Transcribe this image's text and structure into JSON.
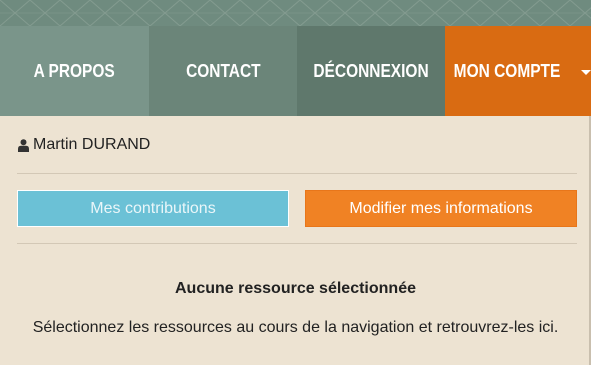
{
  "nav": {
    "apropos": "A PROPOS",
    "contact": "CONTACT",
    "deconnexion": "DÉCONNEXION",
    "compte": "MON COMPTE"
  },
  "user": {
    "name": "Martin DURAND",
    "icon": "user-icon"
  },
  "buttons": {
    "contributions": "Mes contributions",
    "modifier": "Modifier mes informations"
  },
  "empty_state": {
    "title": "Aucune ressource sélectionnée",
    "text": "Sélectionnez les ressources au cours de la navigation et retrouvrez-les ici."
  },
  "colors": {
    "nav_apropos": "#7a958a",
    "nav_contact": "#6b8579",
    "nav_deconnexion": "#5f786c",
    "nav_compte": "#d96b12",
    "panel_bg": "#ede3d2",
    "btn_contributions": "#6bc1d6",
    "btn_modifier": "#f08224"
  }
}
